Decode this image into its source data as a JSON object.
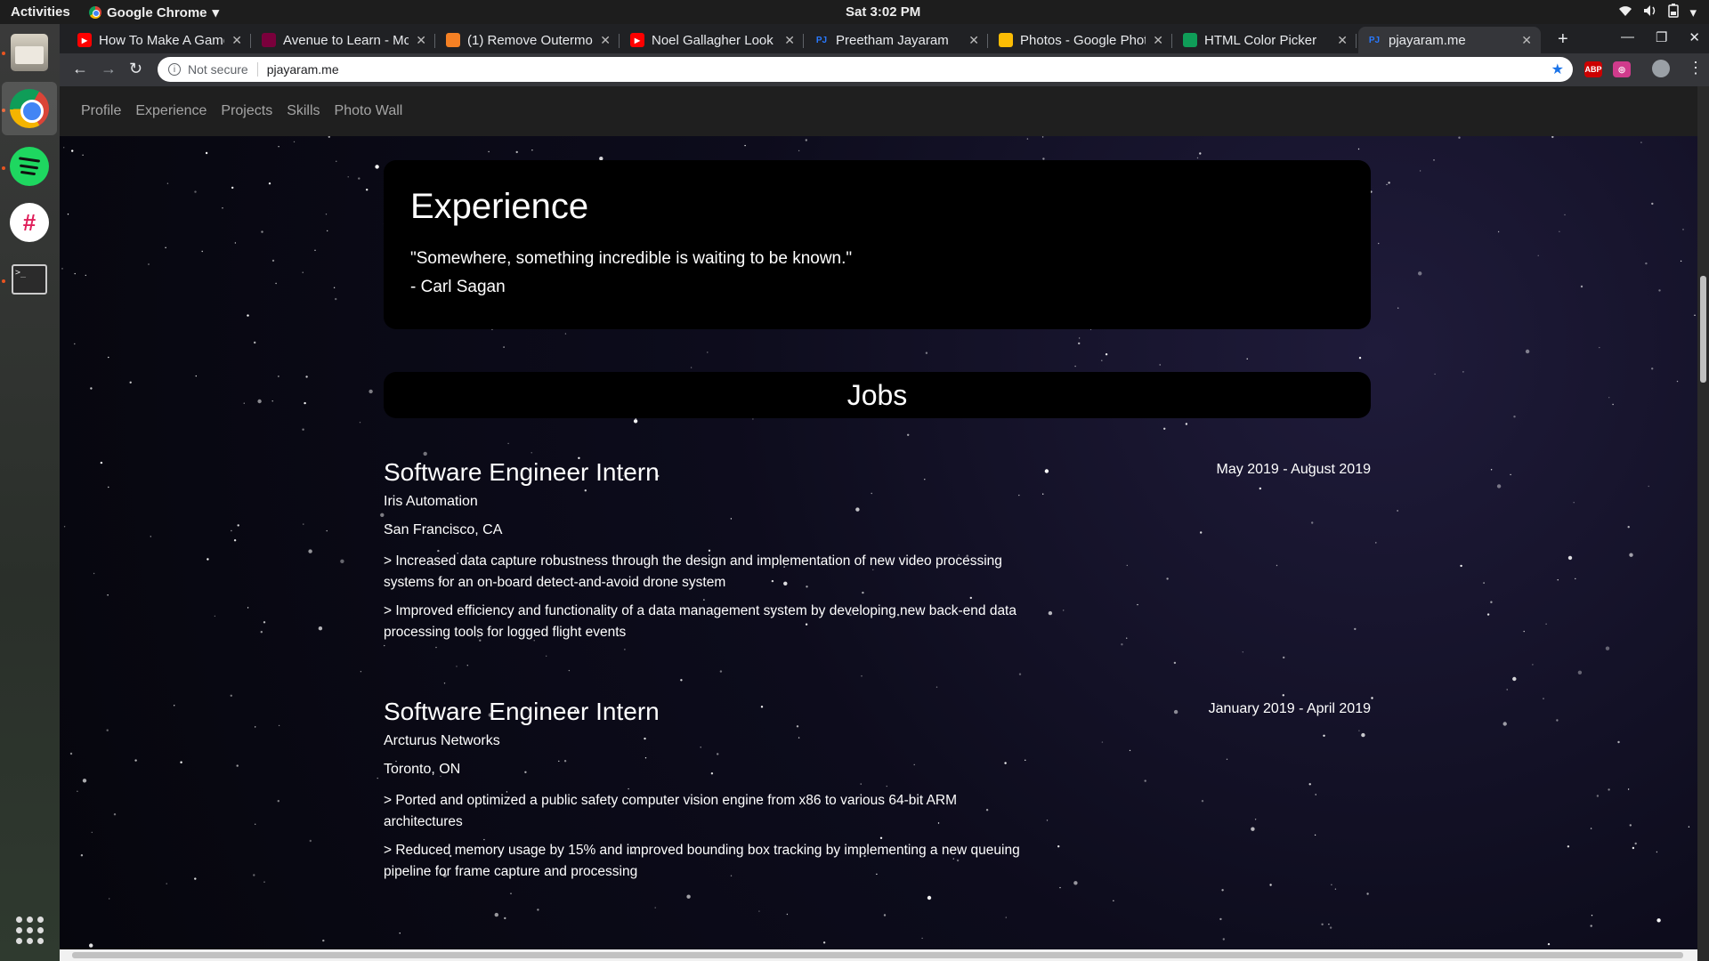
{
  "system": {
    "activities": "Activities",
    "app_name": "Google Chrome",
    "clock": "Sat  3:02 PM"
  },
  "tabs": [
    {
      "label": "How To Make A Game",
      "favicon_color": "#ff0000",
      "icon": "youtube-icon"
    },
    {
      "label": "Avenue to Learn - Mc",
      "favicon_color": "#7a003c",
      "icon": "avenue-icon"
    },
    {
      "label": "(1) Remove Outermo",
      "favicon_color": "#f48024",
      "icon": "stackoverflow-icon"
    },
    {
      "label": "Noel Gallagher Look",
      "favicon_color": "#ff0000",
      "icon": "youtube-icon"
    },
    {
      "label": "Preetham Jayaram",
      "favicon_color": "#2979ff",
      "icon": "pj-icon"
    },
    {
      "label": "Photos - Google Phot",
      "favicon_color": "#fbbc04",
      "icon": "photos-icon"
    },
    {
      "label": "HTML Color Picker",
      "favicon_color": "#0f9d58",
      "icon": "colorpicker-icon"
    },
    {
      "label": "pjayaram.me",
      "favicon_color": "#2979ff",
      "icon": "pj-icon",
      "active": true
    }
  ],
  "favicon_pj": "PJ",
  "omnibox": {
    "security": "Not secure",
    "url": "pjayaram.me"
  },
  "site_nav": [
    "Profile",
    "Experience",
    "Projects",
    "Skills",
    "Photo Wall"
  ],
  "hero": {
    "title": "Experience",
    "quote": "\"Somewhere, something incredible is waiting to be known.\"",
    "author": "- Carl Sagan"
  },
  "jobs_heading": "Jobs",
  "jobs": [
    {
      "title": "Software Engineer Intern",
      "dates": "May 2019 - August 2019",
      "company": "Iris Automation",
      "location": "San Francisco, CA",
      "bullets": [
        "> Increased data capture robustness through the design and implementation of new video processing systems for an on-board detect-and-avoid drone system",
        "> Improved efficiency and functionality of a data management system by developing new back-end data processing tools for logged flight events"
      ]
    },
    {
      "title": "Software Engineer Intern",
      "dates": "January 2019 - April 2019",
      "company": "Arcturus Networks",
      "location": "Toronto, ON",
      "bullets": [
        "> Ported and optimized a public safety computer vision engine from x86 to various 64-bit ARM architectures",
        "> Reduced memory usage by 15% and improved bounding box tracking by implementing a new queuing pipeline for frame capture and processing"
      ]
    }
  ]
}
